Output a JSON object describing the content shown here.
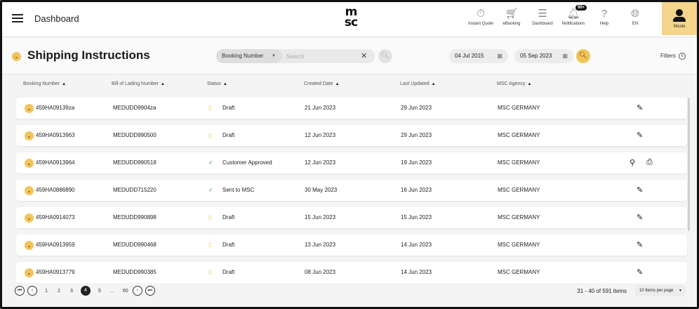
{
  "header": {
    "title": "Dashboard",
    "logo_line1": "m",
    "logo_line2": "sc",
    "nav": [
      {
        "label": "Instant Quote",
        "icon": "stopwatch-icon"
      },
      {
        "label": "eBooking",
        "icon": "cart-icon"
      },
      {
        "label": "Dashboard",
        "icon": "sliders-icon"
      },
      {
        "label": "Notifications",
        "icon": "bell-icon",
        "badge": "99+"
      },
      {
        "label": "Help",
        "icon": "help-chat-icon"
      },
      {
        "label": "EN",
        "icon": "globe-icon"
      }
    ],
    "user": "Nicolo"
  },
  "toolbar": {
    "page_title": "Shipping Instructions",
    "search_type": "Booking Number",
    "search_placeholder": "Search",
    "date_from": "04 Jul 2015",
    "date_to": "05 Sep 2023",
    "filters_label": "Filters"
  },
  "columns": [
    "Booking Number",
    "Bill of Lading Number",
    "Status",
    "Created Date",
    "Last Updated",
    "MSC Agency"
  ],
  "rows": [
    {
      "booking": "459HA09139za",
      "bol": "MEDUDD9904za",
      "status": "Draft",
      "status_type": "draft",
      "created": "21 Jun 2023",
      "updated": "29 Jun 2023",
      "agency": "MSC GERMANY",
      "actions": "edit"
    },
    {
      "booking": "459HA0913963",
      "bol": "MEDUDD990500",
      "status": "Draft",
      "status_type": "draft",
      "created": "12 Jun 2023",
      "updated": "29 Jun 2023",
      "agency": "MSC GERMANY",
      "actions": "edit"
    },
    {
      "booking": "459HA0913964",
      "bol": "MEDUDD990518",
      "status": "Customer Approved",
      "status_type": "ok",
      "created": "12 Jun 2023",
      "updated": "19 Jun 2023",
      "agency": "MSC GERMANY",
      "actions": "view-print"
    },
    {
      "booking": "459HA0886890",
      "bol": "MEDUDD715220",
      "status": "Sent to MSC",
      "status_type": "ok",
      "created": "30 May 2023",
      "updated": "16 Jun 2023",
      "agency": "MSC GERMANY",
      "actions": "edit"
    },
    {
      "booking": "459HA0914073",
      "bol": "MEDUDD990898",
      "status": "Draft",
      "status_type": "draft",
      "created": "15 Jun 2023",
      "updated": "15 Jun 2023",
      "agency": "MSC GERMANY",
      "actions": "edit"
    },
    {
      "booking": "459HA0913959",
      "bol": "MEDUDD990468",
      "status": "Draft",
      "status_type": "draft",
      "created": "13 Jun 2023",
      "updated": "14 Jun 2023",
      "agency": "MSC GERMANY",
      "actions": "edit"
    },
    {
      "booking": "459HA0913779",
      "bol": "MEDUDD990385",
      "status": "Draft",
      "status_type": "draft",
      "created": "08 Jun 2023",
      "updated": "14 Jun 2023",
      "agency": "MSC GERMANY",
      "actions": "edit"
    }
  ],
  "pagination": {
    "pages": [
      "1",
      "2",
      "3",
      "4",
      "5"
    ],
    "current": "4",
    "ellipsis": "...",
    "last": "60",
    "items_count": "31 - 40 of 591 items",
    "per_page": "10 Items per page"
  },
  "colors": {
    "accent": "#f2c55a",
    "user_bg": "#f5d58b",
    "ok": "#2e8b3a"
  }
}
